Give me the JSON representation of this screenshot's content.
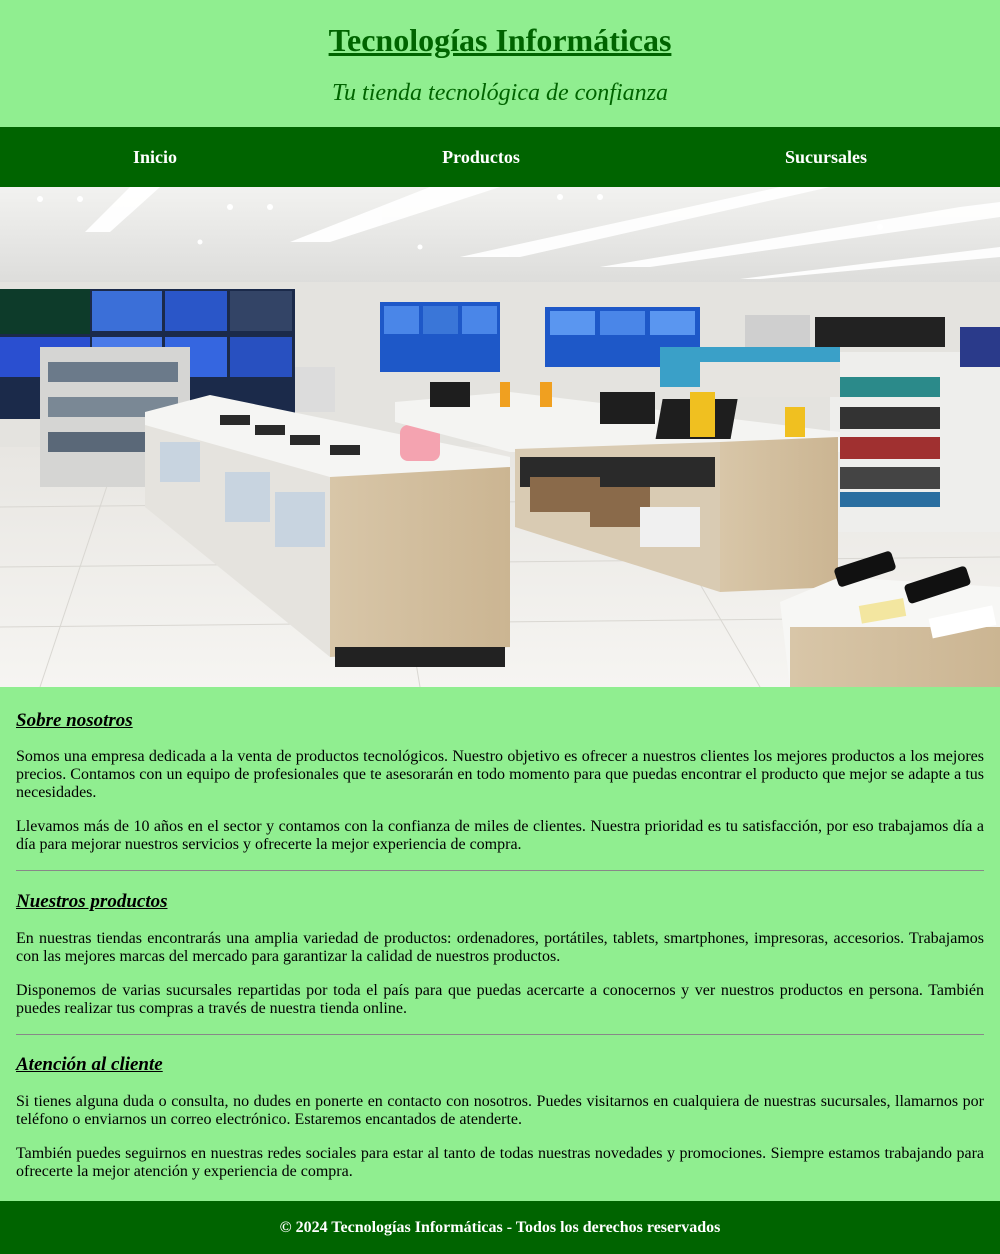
{
  "header": {
    "title": "Tecnologías Informáticas",
    "tagline": "Tu tienda tecnológica de confianza"
  },
  "nav": {
    "items": [
      {
        "label": "Inicio"
      },
      {
        "label": "Productos"
      },
      {
        "label": "Sucursales"
      }
    ]
  },
  "hero": {
    "description": "store-interior-photo"
  },
  "sections": [
    {
      "heading": "Sobre nosotros",
      "paragraphs": [
        "Somos una empresa dedicada a la venta de productos tecnológicos. Nuestro objetivo es ofrecer a nuestros clientes los mejores productos a los mejores precios. Contamos con un equipo de profesionales que te asesorarán en todo momento para que puedas encontrar el producto que mejor se adapte a tus necesidades.",
        "Llevamos más de 10 años en el sector y contamos con la confianza de miles de clientes. Nuestra prioridad es tu satisfacción, por eso trabajamos día a día para mejorar nuestros servicios y ofrecerte la mejor experiencia de compra."
      ]
    },
    {
      "heading": "Nuestros productos",
      "paragraphs": [
        "En nuestras tiendas encontrarás una amplia variedad de productos: ordenadores, portátiles, tablets, smartphones, impresoras, accesorios. Trabajamos con las mejores marcas del mercado para garantizar la calidad de nuestros productos.",
        "Disponemos de varias sucursales repartidas por toda el país para que puedas acercarte a conocernos y ver nuestros productos en persona. También puedes realizar tus compras a través de nuestra tienda online."
      ]
    },
    {
      "heading": "Atención al cliente",
      "paragraphs": [
        "Si tienes alguna duda o consulta, no dudes en ponerte en contacto con nosotros. Puedes visitarnos en cualquiera de nuestras sucursales, llamarnos por teléfono o enviarnos un correo electrónico. Estaremos encantados de atenderte.",
        "También puedes seguirnos en nuestras redes sociales para estar al tanto de todas nuestras novedades y promociones. Siempre estamos trabajando para ofrecerte la mejor atención y experiencia de compra."
      ]
    }
  ],
  "footer": {
    "text": "© 2024 Tecnologías Informáticas - Todos los derechos reservados"
  },
  "colors": {
    "background": "#90ee90",
    "primary": "#006400",
    "nav_text": "#ffffff"
  }
}
